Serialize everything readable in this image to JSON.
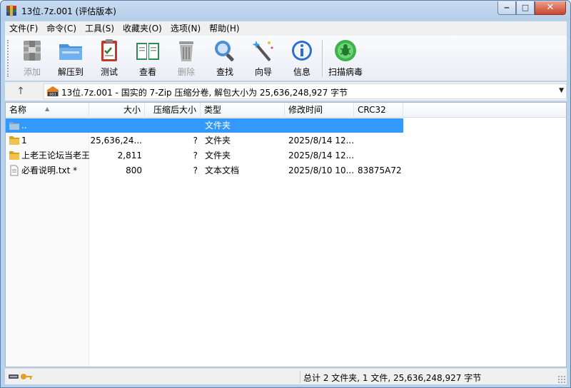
{
  "window": {
    "title": "13位.7z.001 (评估版本)"
  },
  "menu": [
    "文件(F)",
    "命令(C)",
    "工具(S)",
    "收藏夹(O)",
    "选项(N)",
    "帮助(H)"
  ],
  "toolbar": {
    "add": "添加",
    "extract": "解压到",
    "test": "测试",
    "view": "查看",
    "delete": "删除",
    "find": "查找",
    "wizard": "向导",
    "info": "信息",
    "scan": "扫描病毒"
  },
  "address": {
    "text": "13位.7z.001 - 国实的 7-Zip 压缩分卷, 解包大小为 25,636,248,927 字节"
  },
  "columns": {
    "name": "名称",
    "size": "大小",
    "packed": "压缩后大小",
    "type": "类型",
    "modified": "修改时间",
    "crc": "CRC32"
  },
  "rows": [
    {
      "name": "..",
      "size": "",
      "packed": "",
      "type": "文件夹",
      "modified": "",
      "crc": ""
    },
    {
      "name": "1",
      "size": "25,636,24...",
      "packed": "?",
      "type": "文件夹",
      "modified": "2025/8/14 12...",
      "crc": ""
    },
    {
      "name": "上老王论坛当老王",
      "size": "2,811",
      "packed": "?",
      "type": "文件夹",
      "modified": "2025/8/14 12...",
      "crc": ""
    },
    {
      "name": "必看说明.txt *",
      "size": "800",
      "packed": "?",
      "type": "文本文档",
      "modified": "2025/8/10 10...",
      "crc": "83875A72"
    }
  ],
  "status": {
    "summary": "总计 2 文件夹, 1 文件, 25,636,248,927 字节"
  },
  "colors": {
    "selection": "#3399ff",
    "folder": "#f2c14e",
    "frame": "#b9d1ea"
  }
}
